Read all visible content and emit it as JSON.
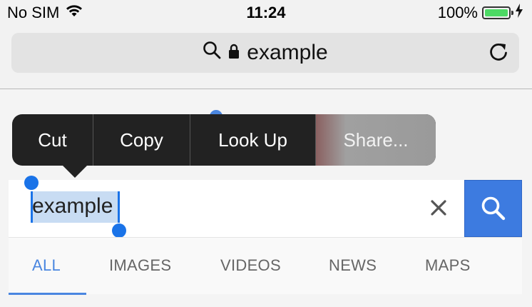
{
  "status_bar": {
    "carrier": "No SIM",
    "time": "11:24",
    "battery_percent": "100%",
    "battery_level": 1.0,
    "battery_color": "#4cd964"
  },
  "url_bar": {
    "url_text": "example",
    "icons": [
      "search-icon",
      "lock-icon",
      "reload-icon"
    ]
  },
  "context_menu": {
    "items": [
      "Cut",
      "Copy",
      "Look Up",
      "Share..."
    ]
  },
  "search": {
    "query": "example",
    "selected_text": "example",
    "accent_color": "#3d7be0"
  },
  "tabs": {
    "items": [
      "ALL",
      "IMAGES",
      "VIDEOS",
      "NEWS",
      "MAPS"
    ],
    "active": "ALL"
  }
}
